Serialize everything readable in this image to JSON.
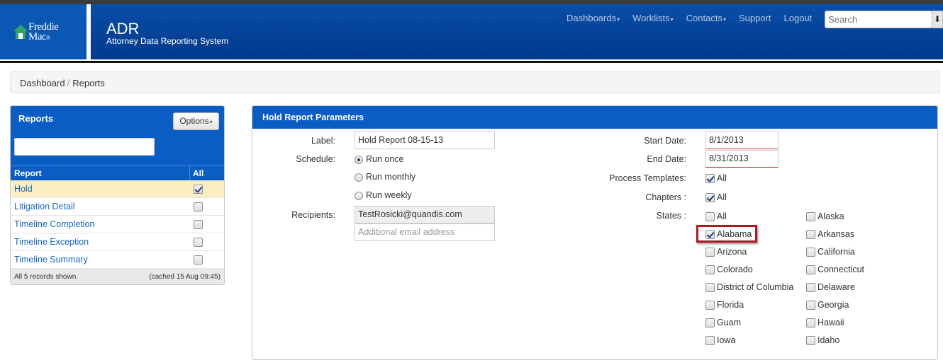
{
  "header": {
    "logo_line1": "Freddie",
    "logo_line2": "Mac",
    "app_title": "ADR",
    "app_subtitle": "Attorney Data Reporting System",
    "nav": [
      "Dashboards",
      "Worklists",
      "Contacts",
      "Support",
      "Logout"
    ],
    "search_placeholder": "Search",
    "search_button": "⬇"
  },
  "breadcrumb": {
    "items": [
      "Dashboard",
      "Reports"
    ],
    "separator": "/"
  },
  "reports_panel": {
    "title": "Reports",
    "options_label": "Options",
    "filter_value": "",
    "columns": [
      "Report",
      "All"
    ],
    "rows": [
      {
        "name": "Hold",
        "checked": true,
        "selected": true
      },
      {
        "name": "Litigation Detail",
        "checked": false,
        "selected": false
      },
      {
        "name": "Timeline Completion",
        "checked": false,
        "selected": false
      },
      {
        "name": "Timeline Exception",
        "checked": false,
        "selected": false
      },
      {
        "name": "Timeline Summary",
        "checked": false,
        "selected": false
      }
    ],
    "footer_left": "All 5 records shown.",
    "footer_right": "(cached 15 Aug 09:45)"
  },
  "params_panel": {
    "title": "Hold Report Parameters",
    "label_label": "Label:",
    "label_value": "Hold Report 08-15-13",
    "schedule_label": "Schedule:",
    "schedule_options": [
      {
        "label": "Run once",
        "selected": true
      },
      {
        "label": "Run monthly",
        "selected": false
      },
      {
        "label": "Run weekly",
        "selected": false
      }
    ],
    "recipients_label": "Recipients:",
    "recipients_value": "TestRosicki@quandis.com",
    "additional_placeholder": "Additional email address",
    "start_date_label": "Start Date:",
    "start_date_value": "8/1/2013",
    "end_date_label": "End Date:",
    "end_date_value": "8/31/2013",
    "process_templates_label": "Process Templates:",
    "process_templates_all": "All",
    "chapters_label": "Chapters :",
    "chapters_all": "All",
    "states_label": "States :",
    "states_col1": [
      {
        "name": "All",
        "checked": false
      },
      {
        "name": "Alabama",
        "checked": true
      },
      {
        "name": "Arizona",
        "checked": false
      },
      {
        "name": "Colorado",
        "checked": false
      },
      {
        "name": "District of Columbia",
        "checked": false
      },
      {
        "name": "Florida",
        "checked": false
      },
      {
        "name": "Guam",
        "checked": false
      },
      {
        "name": "Iowa",
        "checked": false
      }
    ],
    "states_col2": [
      {
        "name": "Alaska",
        "checked": false
      },
      {
        "name": "Arkansas",
        "checked": false
      },
      {
        "name": "California",
        "checked": false
      },
      {
        "name": "Connecticut",
        "checked": false
      },
      {
        "name": "Delaware",
        "checked": false
      },
      {
        "name": "Georgia",
        "checked": false
      },
      {
        "name": "Hawaii",
        "checked": false
      },
      {
        "name": "Idaho",
        "checked": false
      }
    ]
  },
  "colors": {
    "nav_blue": "#003a8c",
    "panel_blue": "#0b5dc6",
    "link_blue": "#1a66c4",
    "highlight_red": "#b01820",
    "selected_row": "#fbeec2"
  }
}
